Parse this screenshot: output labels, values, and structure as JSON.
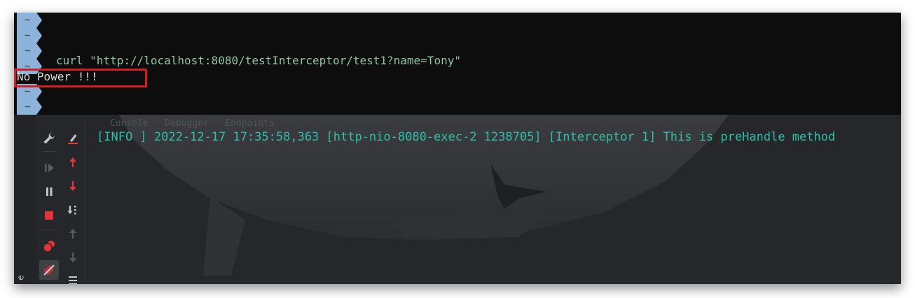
{
  "terminal": {
    "tilde": "~",
    "command": "curl \"http://localhost:8080/testInterceptor/test1?name=Tony\"",
    "output": "No Power !!!"
  },
  "console": {
    "log_line": "[INFO ] 2022-12-17 17:35:58,363 [http-nio-8080-exec-2 1238705] [Interceptor 1] This is preHandle method",
    "tabs": [
      "Console",
      "Debugger",
      "Endpoints"
    ],
    "sidebar_label": "e"
  },
  "colors": {
    "terminal_bg": "#0d0d0d",
    "prompt_block": "#8db3da",
    "command_text": "#8fc3a6",
    "log_text": "#2fbfa8",
    "highlight": "#d11d24",
    "console_bg": "#25272a"
  },
  "icons": {
    "col1": [
      "wrench-icon",
      "resume-icon",
      "pause-icon",
      "stop-icon",
      "breakpoints-icon",
      "mute-breakpoints-icon"
    ],
    "col2": [
      "clear-all-icon",
      "up-arrow-icon",
      "down-arrow-icon",
      "sort-icon",
      "up-arrow-icon",
      "down-arrow-icon",
      "menu-icon"
    ]
  }
}
